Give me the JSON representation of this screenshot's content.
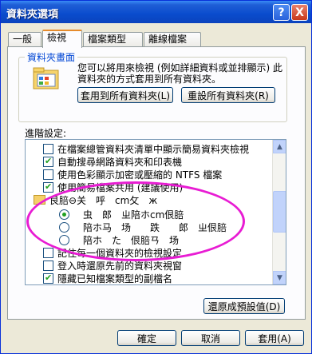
{
  "window": {
    "title": "資料夾選項"
  },
  "title_buttons": {
    "help": "?",
    "close": "X"
  },
  "tabs": [
    {
      "label": "一般"
    },
    {
      "label": "檢視"
    },
    {
      "label": "檔案類型"
    },
    {
      "label": "離線檔案"
    }
  ],
  "folder_views": {
    "group_label": "資料夾畫面",
    "description": "您可以將用來檢視 (例如詳細資料或並排顯示) 此資料夾的方式套用到所有資料夾。",
    "apply_button": "套用到所有資料夾(L)",
    "reset_button": "重設所有資料夾(R)"
  },
  "advanced": {
    "label": "進階設定:",
    "items": [
      {
        "text": "在檔案總管資料夾清單中顯示簡易資料夾檢視",
        "checked": false
      },
      {
        "text": "自動搜尋網路資料夾和印表機",
        "checked": true
      },
      {
        "text": "使用色彩顯示加密或壓縮的 NTFS 檔案",
        "checked": false
      },
      {
        "text": "使用簡易檔案共用 (建議使用)",
        "checked": true
      },
      {
        "text": "艮䏽⊖关　呼　cm攵　ж",
        "type": "folder"
      },
      {
        "text": "　虫　郎　ㄓ陪ホcm佷䏽",
        "type": "radio",
        "checked": true
      },
      {
        "text": "　陪ホ马　场　　跌　　郎　ㄓ佷䏽",
        "type": "radio",
        "checked": false
      },
      {
        "text": "　陪ホ　た　佷䏽ㄢ　场",
        "type": "radio",
        "checked": false
      },
      {
        "text": "記住每一個資料夾的檢視設定",
        "checked": false
      },
      {
        "text": "登入時還原先前的資料夾視窗",
        "checked": false
      },
      {
        "text": "隱藏已知檔案類型的副檔名",
        "checked": true
      }
    ]
  },
  "restore_defaults": "還原成預設值(D)",
  "footer": {
    "ok": "確定",
    "cancel": "取消",
    "apply": "套用(A)"
  }
}
